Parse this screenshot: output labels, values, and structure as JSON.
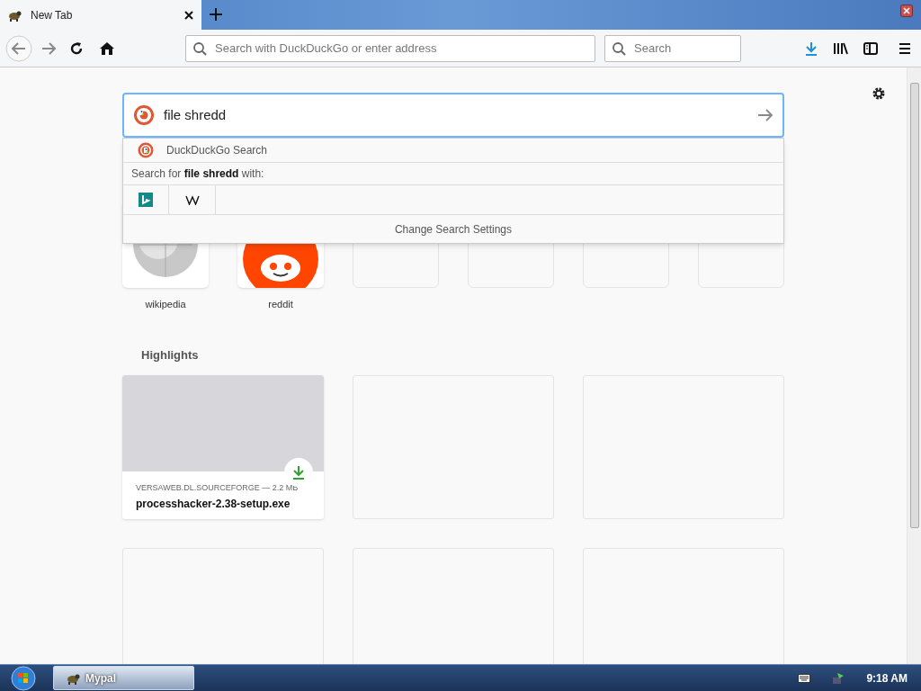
{
  "tabs": [
    {
      "title": "New Tab",
      "selected": true
    }
  ],
  "address_bar": {
    "placeholder": "Search with DuckDuckGo or enter address"
  },
  "search_bar": {
    "placeholder": "Search"
  },
  "page_search": {
    "value": "file shredd"
  },
  "dropdown": {
    "engine": "DuckDuckGo Search",
    "search_for": "Search for **file shredd** with:",
    "settings": "Change Search Settings"
  },
  "top_sites": [
    {
      "label": "wikipedia",
      "kind": "wikipedia"
    },
    {
      "label": "reddit",
      "kind": "reddit"
    },
    {
      "kind": "empty"
    },
    {
      "kind": "empty"
    },
    {
      "kind": "empty"
    },
    {
      "kind": "empty"
    }
  ],
  "highlights": {
    "title": "Highlights",
    "cards": [
      {
        "kind": "download",
        "source": "VERSAWEB.DL.SOURCEFORGE — 2.2 MB",
        "title": "processhacker-2.38-setup.exe"
      },
      {
        "kind": "empty"
      },
      {
        "kind": "empty"
      },
      {
        "kind": "empty"
      },
      {
        "kind": "empty"
      },
      {
        "kind": "empty"
      }
    ]
  },
  "taskbar": {
    "app": "Mypal",
    "time": "9:18 AM"
  }
}
